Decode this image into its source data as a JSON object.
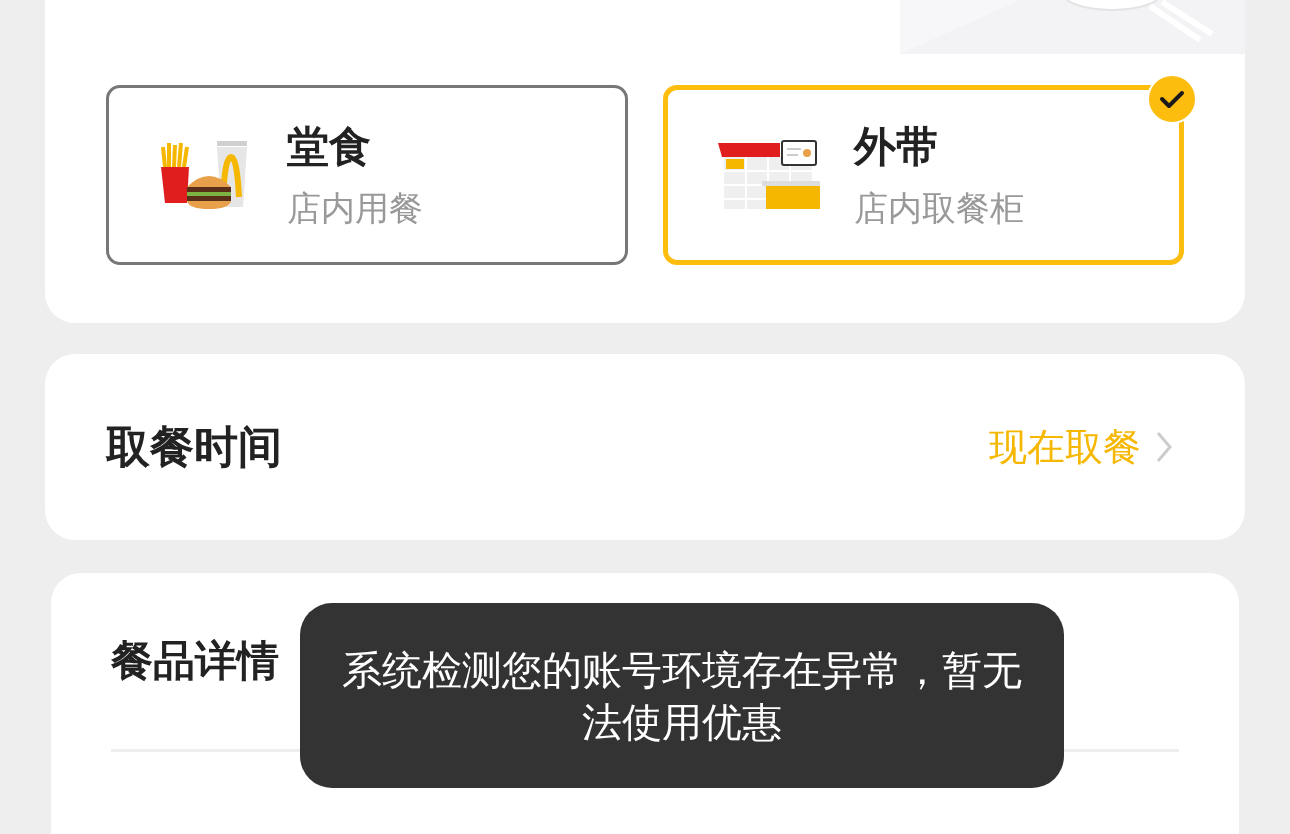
{
  "order_modes": [
    {
      "kind": "dine_in",
      "title": "堂食",
      "subtitle": "店内用餐",
      "selected": false
    },
    {
      "kind": "takeout",
      "title": "外带",
      "subtitle": "店内取餐柜",
      "selected": true
    }
  ],
  "pickup_time": {
    "label": "取餐时间",
    "value": "现在取餐"
  },
  "meal_details": {
    "title": "餐品详情"
  },
  "toast": {
    "message": "系统检测您的账号环境存在异常，暂无法使用优惠"
  }
}
